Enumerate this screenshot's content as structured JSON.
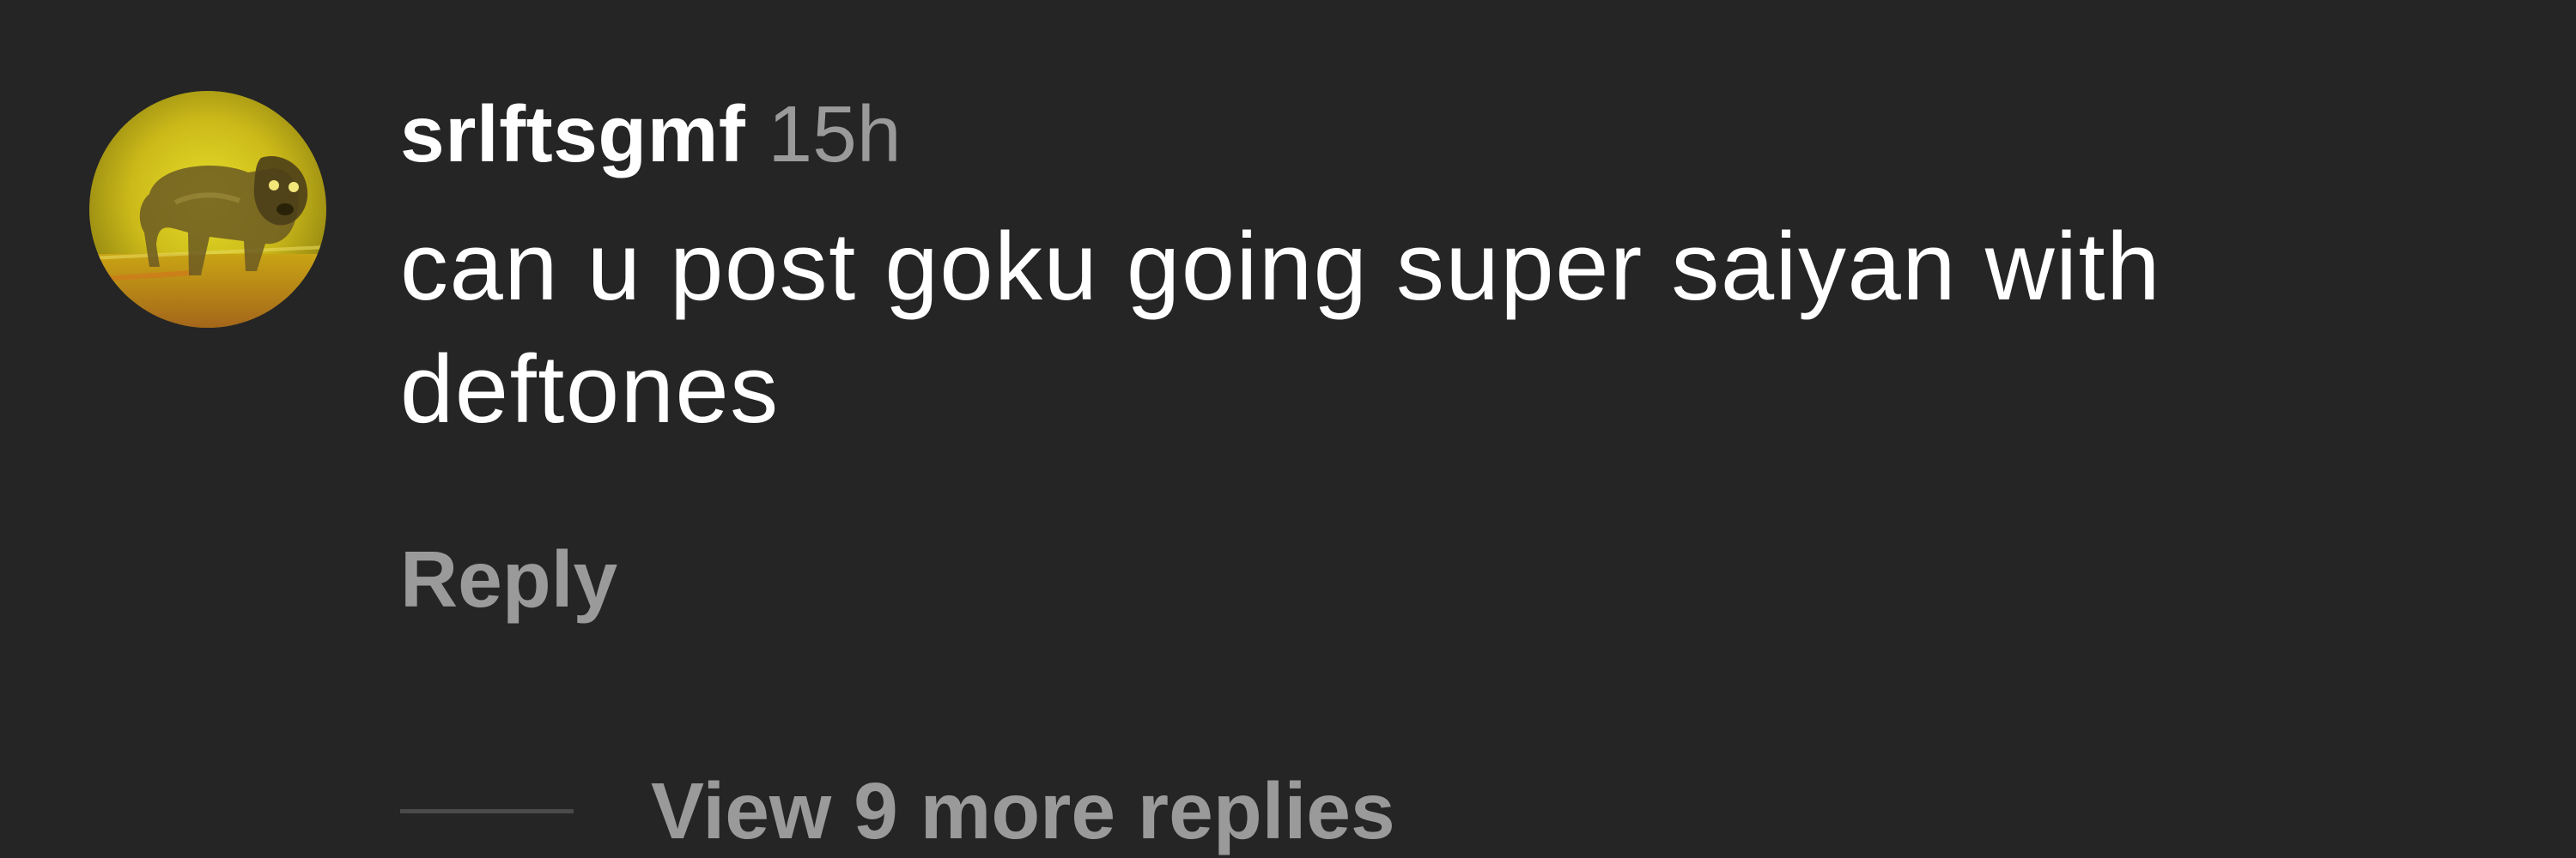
{
  "comment": {
    "username": "srlftsgmf",
    "timestamp": "15h",
    "text": "can u post goku going super saiyan with deftones",
    "avatar_icon": "dog-photo-avatar",
    "reply_label": "Reply",
    "view_replies_label": "View 9 more replies"
  },
  "colors": {
    "background": "#252525",
    "primary_text": "#ffffff",
    "secondary_text": "#9a9a9a",
    "divider": "#4a4a4a",
    "avatar_accent": "#d4c21a"
  }
}
